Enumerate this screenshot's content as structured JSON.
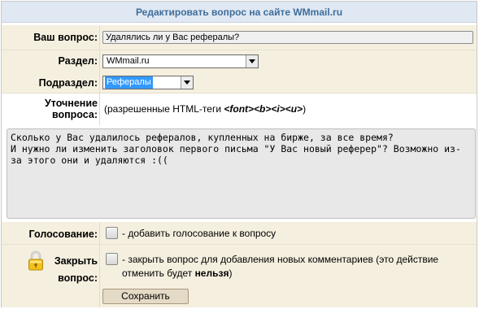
{
  "header": {
    "title": "Редактировать вопрос на сайте WMmail.ru"
  },
  "question": {
    "label": "Ваш вопрос:",
    "value": "Удалялись ли у Вас рефералы?"
  },
  "section": {
    "label": "Раздел:",
    "selected": "WMmail.ru"
  },
  "subsection": {
    "label": "Подраздел:",
    "selected": "Рефералы"
  },
  "clarification": {
    "label_line1": "Уточнение",
    "label_line2": "вопроса:",
    "hint_prefix": "(разрешенные HTML-теги ",
    "hint_tags": "<font><b><i><u>",
    "hint_suffix": ")",
    "text": "Сколько у Вас удалилось рефералов, купленных на бирже, за все время?\nИ нужно ли изменить заголовок первого письма \"У Вас новый реферер\"? Возможно из-\nза этого они и удаляются :(("
  },
  "voting": {
    "label": "Голосование:",
    "checkbox_text": "- добавить голосование к вопросу"
  },
  "close": {
    "label_line1": "Закрыть",
    "label_line2": "вопрос:",
    "checkbox_text_line1": "- закрыть вопрос для добавления новых комментариев (это действие",
    "checkbox_text_line2_prefix": "отменить будет ",
    "checkbox_text_line2_bold": "нельзя",
    "checkbox_text_line2_suffix": ")",
    "icon": "lock-icon"
  },
  "save_button": {
    "label": "Сохранить"
  },
  "colors": {
    "header_bg": "#dfe8f3",
    "header_text": "#3e6d9a",
    "row_beige": "#f5efdf",
    "button_bg": "#e5dac6"
  }
}
